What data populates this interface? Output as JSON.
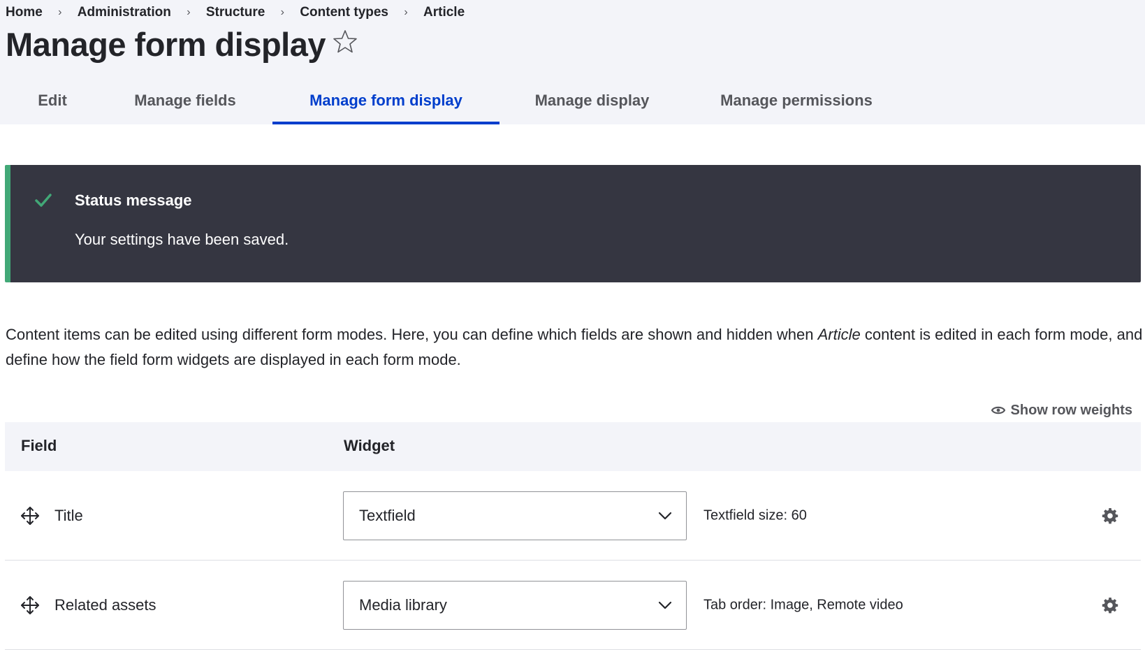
{
  "breadcrumb": [
    "Home",
    "Administration",
    "Structure",
    "Content types",
    "Article"
  ],
  "breadcrumb_separator": "›",
  "page_title": "Manage form display",
  "tabs": [
    {
      "label": "Edit",
      "active": false
    },
    {
      "label": "Manage fields",
      "active": false
    },
    {
      "label": "Manage form display",
      "active": true
    },
    {
      "label": "Manage display",
      "active": false
    },
    {
      "label": "Manage permissions",
      "active": false
    }
  ],
  "status": {
    "title": "Status message",
    "text": "Your settings have been saved."
  },
  "description": {
    "before": "Content items can be edited using different form modes. Here, you can define which fields are shown and hidden when ",
    "emphasis": "Article",
    "after": " content is edited in each form mode, and define how the field form widgets are displayed in each form mode."
  },
  "show_row_weights": "Show row weights",
  "table": {
    "headers": {
      "field": "Field",
      "widget": "Widget"
    },
    "rows": [
      {
        "field": "Title",
        "widget": "Textfield",
        "summary": "Textfield size: 60"
      },
      {
        "field": "Related assets",
        "widget": "Media library",
        "summary": "Tab order: Image, Remote video"
      }
    ]
  },
  "icons": {
    "favorite": "star-icon",
    "status": "check-icon",
    "show_weights": "eye-icon",
    "drag": "drag-handle-icon",
    "select": "chevron-down-icon",
    "settings": "gear-icon"
  },
  "colors": {
    "accent": "#003ecc",
    "status_bg": "#353641",
    "status_border": "#42a877",
    "header_bg": "#f3f4f9"
  }
}
